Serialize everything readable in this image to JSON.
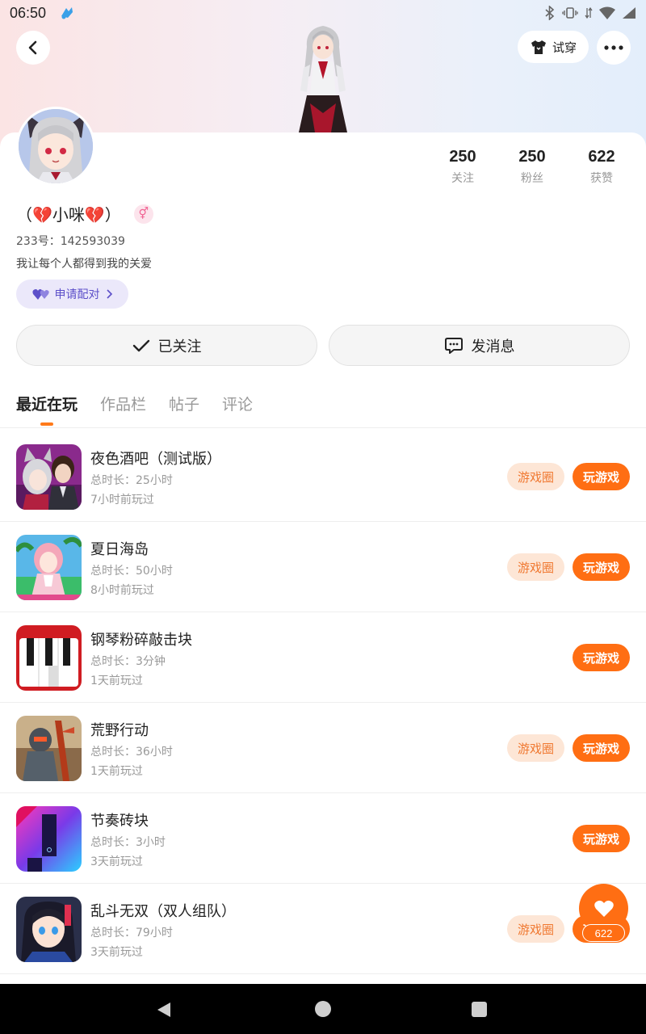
{
  "status_bar": {
    "time": "06:50"
  },
  "header": {
    "tryon_label": "试穿"
  },
  "profile": {
    "name": "（💔小咪💔）",
    "gender_symbol": "⚥",
    "id_text": "233号：142593039",
    "bio": "我让每个人都得到我的关爱",
    "pair_label": "申请配对"
  },
  "stats": [
    {
      "value": "250",
      "label": "关注"
    },
    {
      "value": "250",
      "label": "粉丝"
    },
    {
      "value": "622",
      "label": "获赞"
    }
  ],
  "actions": {
    "follow_label": "已关注",
    "message_label": "发消息"
  },
  "tabs": [
    {
      "label": "最近在玩",
      "active": true
    },
    {
      "label": "作品栏",
      "active": false
    },
    {
      "label": "帖子",
      "active": false
    },
    {
      "label": "评论",
      "active": false
    }
  ],
  "games": [
    {
      "title": "夜色酒吧（测试版）",
      "duration": "总时长：25小时",
      "last_played": "7小时前玩过",
      "circle": "游戏圈",
      "play": "玩游戏"
    },
    {
      "title": "夏日海岛",
      "duration": "总时长：50小时",
      "last_played": "8小时前玩过",
      "circle": "游戏圈",
      "play": "玩游戏"
    },
    {
      "title": "钢琴粉碎敲击块",
      "duration": "总时长：3分钟",
      "last_played": "1天前玩过",
      "circle": "",
      "play": "玩游戏"
    },
    {
      "title": "荒野行动",
      "duration": "总时长：36小时",
      "last_played": "1天前玩过",
      "circle": "游戏圈",
      "play": "玩游戏"
    },
    {
      "title": "节奏砖块",
      "duration": "总时长：3小时",
      "last_played": "3天前玩过",
      "circle": "",
      "play": "玩游戏"
    },
    {
      "title": "乱斗无双（双人组队）",
      "duration": "总时长：79小时",
      "last_played": "3天前玩过",
      "circle": "游戏圈",
      "play": "玩游戏"
    }
  ],
  "like_fab": {
    "count": "622"
  },
  "colors": {
    "accent": "#ff6e13",
    "circle_bg": "#fde6d6",
    "pair_bg": "#ebe8fa",
    "pair_text": "#5c4fc9"
  },
  "icons": {
    "back": "chevron-left-icon",
    "tryon": "shirt-icon",
    "more": "more-dots-icon",
    "follow": "check-icon",
    "message": "chat-bubble-icon",
    "pair": "hearts-icon",
    "like": "heart-icon"
  }
}
